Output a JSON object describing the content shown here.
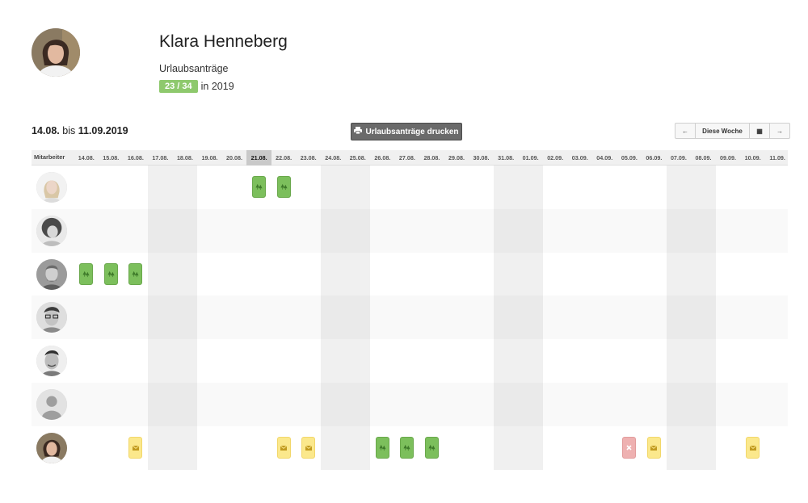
{
  "profile": {
    "name": "Klara Henneberg",
    "subtitle": "Urlaubsanträge",
    "count_badge": "23 / 34",
    "count_suffix": "in 2019"
  },
  "toolbar": {
    "range_from": "14.08.",
    "range_mid": "bis",
    "range_to": "11.09.2019",
    "print_label": "Urlaubsanträge drucken",
    "nav_prev": "←",
    "nav_today": "Diese Woche",
    "nav_calendar": "▦",
    "nav_next": "→"
  },
  "grid": {
    "header_label": "Mitarbeiter",
    "days": [
      "14.08.",
      "15.08.",
      "16.08.",
      "17.08.",
      "18.08.",
      "19.08.",
      "20.08.",
      "21.08.",
      "22.08.",
      "23.08.",
      "24.08.",
      "25.08.",
      "26.08.",
      "27.08.",
      "28.08.",
      "29.08.",
      "30.08.",
      "31.08.",
      "01.09.",
      "02.09.",
      "03.09.",
      "04.09.",
      "05.09.",
      "06.09.",
      "07.09.",
      "08.09.",
      "09.09.",
      "10.09.",
      "11.09."
    ],
    "today_index": 7,
    "weekend_indices": [
      3,
      4,
      10,
      11,
      17,
      18,
      24,
      25
    ],
    "rows": [
      {
        "avatar": "avatar-blonde-woman",
        "chips": [
          {
            "day": 7,
            "type": "approved"
          },
          {
            "day": 8,
            "type": "approved"
          }
        ]
      },
      {
        "avatar": "avatar-curly-woman",
        "chips": []
      },
      {
        "avatar": "avatar-bearded-man",
        "chips": [
          {
            "day": 0,
            "type": "approved"
          },
          {
            "day": 1,
            "type": "approved"
          },
          {
            "day": 2,
            "type": "approved"
          }
        ]
      },
      {
        "avatar": "avatar-glasses-man",
        "chips": []
      },
      {
        "avatar": "avatar-smiling-man",
        "chips": []
      },
      {
        "avatar": "avatar-placeholder",
        "chips": []
      },
      {
        "avatar": "avatar-klara",
        "chips": [
          {
            "day": 2,
            "type": "pending"
          },
          {
            "day": 8,
            "type": "pending"
          },
          {
            "day": 9,
            "type": "pending"
          },
          {
            "day": 12,
            "type": "approved"
          },
          {
            "day": 13,
            "type": "approved"
          },
          {
            "day": 14,
            "type": "approved"
          },
          {
            "day": 22,
            "type": "rejected"
          },
          {
            "day": 23,
            "type": "pending"
          },
          {
            "day": 27,
            "type": "pending"
          }
        ]
      }
    ]
  },
  "colors": {
    "approved": "#7cbf5c",
    "pending": "#fbe88c",
    "rejected": "#eeb1b1",
    "badge": "#8ec96d",
    "weekend": "#f0f0f0"
  },
  "icons": {
    "approved": "tree-icon",
    "pending": "envelope-icon",
    "rejected": "close-icon",
    "print": "printer-icon"
  }
}
